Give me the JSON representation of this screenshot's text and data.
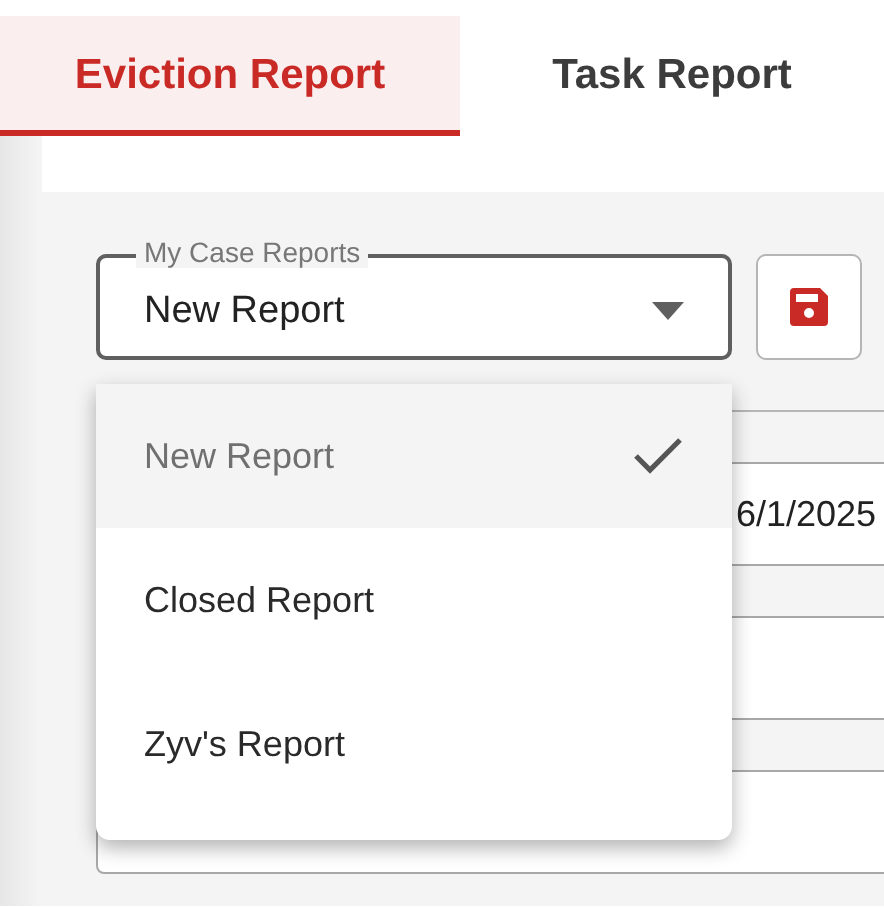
{
  "tabs": [
    {
      "label": "Eviction Report",
      "selected": true
    },
    {
      "label": "Task Report",
      "selected": false
    }
  ],
  "report_select": {
    "label": "My Case Reports",
    "value": "New Report",
    "expanded": true
  },
  "menu": [
    {
      "label": "New Report",
      "selected": true
    },
    {
      "label": "Closed Report",
      "selected": false
    },
    {
      "label": "Zyv's Report",
      "selected": false
    }
  ],
  "date_field": {
    "value": "6/1/2025"
  }
}
